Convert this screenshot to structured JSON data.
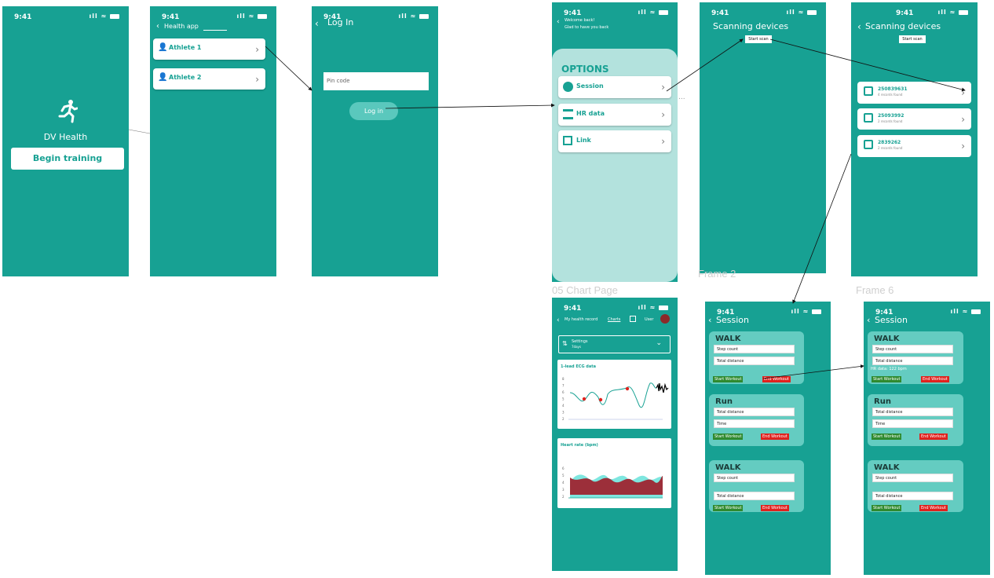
{
  "status": {
    "time": "9:41",
    "icons": "ıll ≈"
  },
  "frames": {
    "f1": {
      "title": "DV Health",
      "button": "Begin training"
    },
    "f2": {
      "header": "Health app",
      "athletes": [
        "Athlete 1",
        "Athlete 2"
      ]
    },
    "f3": {
      "title": "Log In",
      "pin_placeholder": "Pin code",
      "login": "Log in"
    },
    "f4": {
      "welcome": "Welcome back!",
      "sub": "Glad to have you back",
      "options_title": "OPTIONS",
      "options": [
        "Session",
        "HR data",
        "Link"
      ],
      "ellipsis": "..."
    },
    "f5": {
      "title": "Scanning devices",
      "scan": "Start scan"
    },
    "f6": {
      "title": "Scanning devices",
      "scan": "Start scan",
      "devices": [
        {
          "id": "250839631",
          "sub": "4 records found"
        },
        {
          "id": "25093992",
          "sub": "2 records found"
        },
        {
          "id": "2839262",
          "sub": "2 records found"
        }
      ]
    },
    "chart": {
      "nav": "My health record",
      "tab": "Charts",
      "user": "User",
      "settings": "Settings",
      "settings_sub": "7days",
      "ecg_title": "1-lead ECG data",
      "hr_title": "Heart rate (bpm)",
      "y_ticks_ecg": [
        "8",
        "7",
        "6",
        "5",
        "4",
        "3",
        "2"
      ],
      "y_ticks_hr": [
        "6",
        "5",
        "4",
        "3",
        "2"
      ]
    },
    "session": {
      "title": "Session",
      "cards": [
        {
          "name": "WALK",
          "fields": [
            "Step count",
            "Total distance"
          ]
        },
        {
          "name": "Run",
          "fields": [
            "Total distance",
            "Time"
          ]
        },
        {
          "name": "WALK",
          "fields": [
            "Step count",
            "Total distance"
          ]
        }
      ],
      "start": "Start Workout",
      "end": "End Workout",
      "hr_note": "HR data: 122 bpm"
    }
  },
  "labels": {
    "frame2": "Frame 2",
    "frame6": "Frame 6",
    "chart_page": "05 Chart Page"
  },
  "colors": {
    "teal": "#17a193",
    "teal_light": "#64ccc1",
    "panel": "#b3e2dd",
    "red": "#e0221e",
    "green": "#2f8a2f",
    "hr_fill": "#9c2f3a"
  }
}
